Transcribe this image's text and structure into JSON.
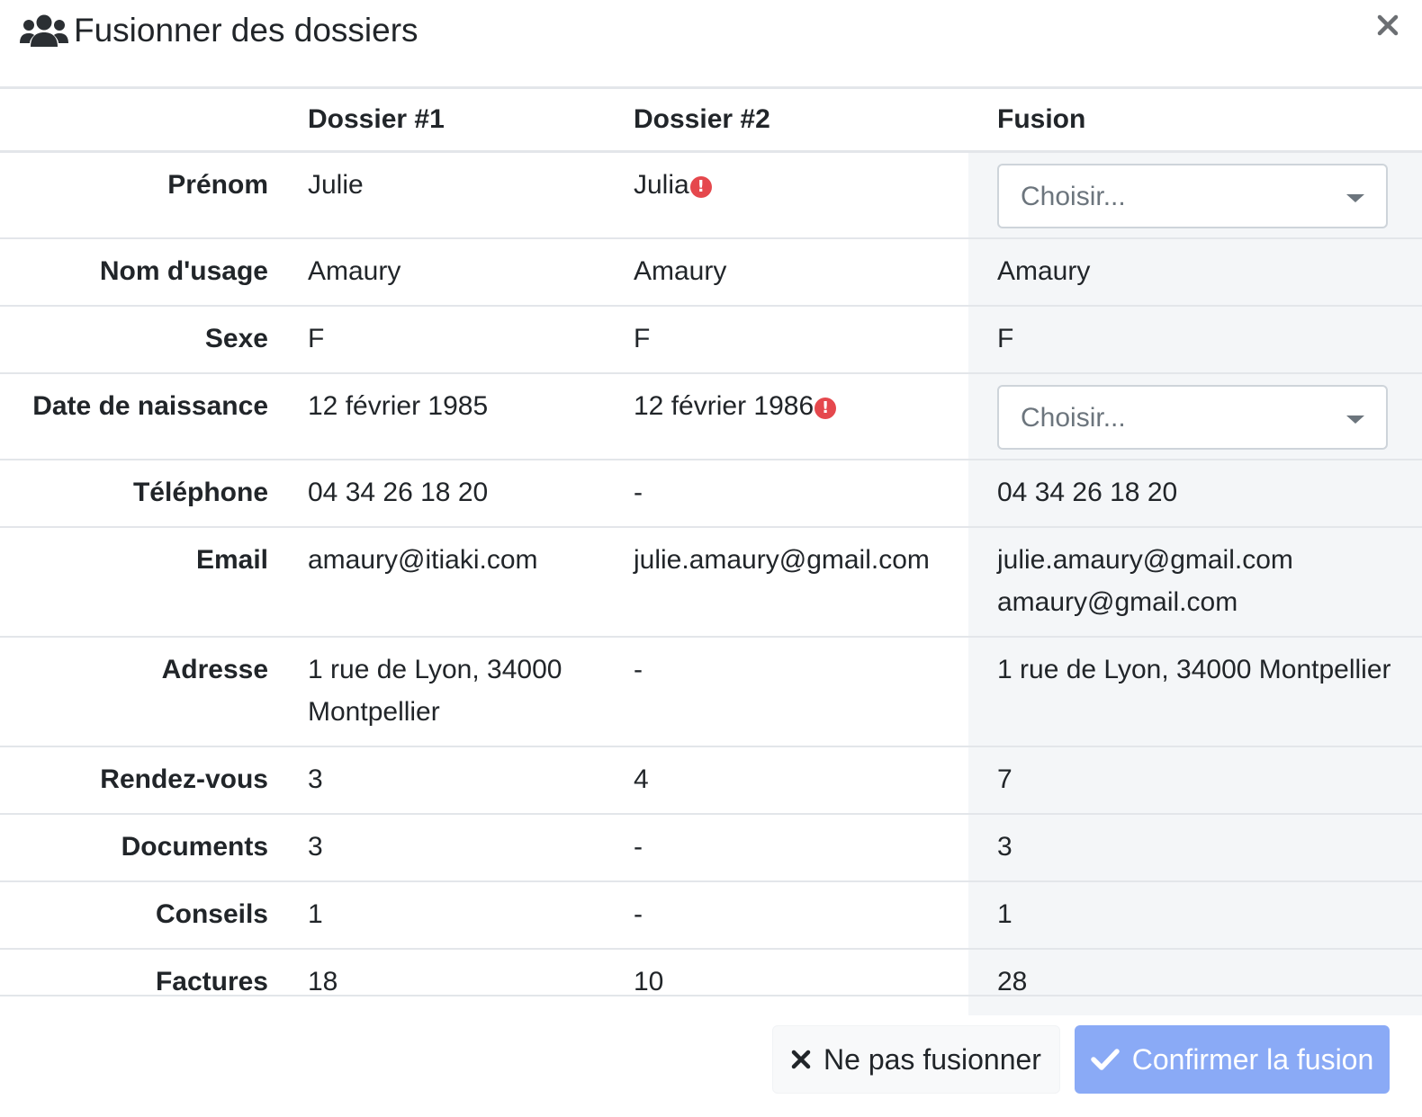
{
  "modal": {
    "title": "Fusionner des dossiers",
    "title_icon": "users-icon",
    "close_icon": "close-icon",
    "close_glyph": "×"
  },
  "table": {
    "headers": [
      "",
      "Dossier #1",
      "Dossier #2",
      "Fusion"
    ],
    "rows": {
      "prenom": {
        "label": "Prénom",
        "d1": "Julie",
        "d2": "Julia",
        "d2_warning": true,
        "fusion_select_placeholder": "Choisir..."
      },
      "nom_usage": {
        "label": "Nom d'usage",
        "d1": "Amaury",
        "d2": "Amaury",
        "fusion": "Amaury"
      },
      "sexe": {
        "label": "Sexe",
        "d1": "F",
        "d2": "F",
        "fusion": "F"
      },
      "naissance": {
        "label": "Date de naissance",
        "d1": "12 février 1985",
        "d2": "12 février 1986",
        "d2_warning": true,
        "fusion_select_placeholder": "Choisir..."
      },
      "telephone": {
        "label": "Téléphone",
        "d1": "04 34 26 18 20",
        "d2": "-",
        "fusion": "04 34 26 18 20"
      },
      "email": {
        "label": "Email",
        "d1": "amaury@itiaki.com",
        "d2": "julie.amaury@gmail.com",
        "fusion_1": "julie.amaury@gmail.com",
        "fusion_2": "amaury@gmail.com"
      },
      "adresse": {
        "label": "Adresse",
        "d1_line1": "1 rue de Lyon, 34000",
        "d1_line2": "Montpellier",
        "d2": "-",
        "fusion": "1 rue de Lyon, 34000 Montpellier"
      },
      "rdv": {
        "label": "Rendez-vous",
        "d1": "3",
        "d2": "4",
        "fusion": "7"
      },
      "documents": {
        "label": "Documents",
        "d1": "3",
        "d2": "-",
        "fusion": "3"
      },
      "conseils": {
        "label": "Conseils",
        "d1": "1",
        "d2": "-",
        "fusion": "1"
      },
      "factures": {
        "label": "Factures",
        "d1": "18",
        "d2": "10",
        "fusion": "28"
      }
    }
  },
  "footer": {
    "cancel_label": "Ne pas fusionner",
    "cancel_icon": "times-icon",
    "confirm_label": "Confirmer la fusion",
    "confirm_icon": "check-icon",
    "confirm_enabled": false
  },
  "colors": {
    "warning": "#e5484d",
    "confirm_bg": "#8aaaf6",
    "fusion_column_bg": "#f4f6f8"
  }
}
